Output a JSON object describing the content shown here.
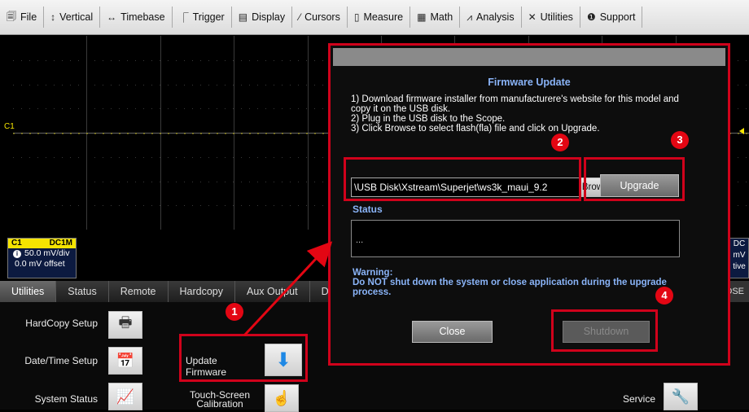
{
  "menu": [
    {
      "icon": "file-icon",
      "glyph": "🗐",
      "label": "File"
    },
    {
      "icon": "vertical-icon",
      "glyph": "↕",
      "label": "Vertical"
    },
    {
      "icon": "timebase-icon",
      "glyph": "↔",
      "label": "Timebase"
    },
    {
      "icon": "trigger-icon",
      "glyph": "⎾",
      "label": "Trigger"
    },
    {
      "icon": "display-icon",
      "glyph": "▤",
      "label": "Display"
    },
    {
      "icon": "cursors-icon",
      "glyph": "⁄",
      "label": "Cursors"
    },
    {
      "icon": "measure-icon",
      "glyph": "▯",
      "label": "Measure"
    },
    {
      "icon": "math-icon",
      "glyph": "▦",
      "label": "Math"
    },
    {
      "icon": "analysis-icon",
      "glyph": "⩘",
      "label": "Analysis"
    },
    {
      "icon": "utilities-icon",
      "glyph": "✕",
      "label": "Utilities"
    },
    {
      "icon": "support-icon",
      "glyph": "❶",
      "label": "Support"
    }
  ],
  "grid": {
    "channel_marker": "C1"
  },
  "channel": {
    "name": "C1",
    "coupling": "DC1M",
    "scale": "50.0 mV/div",
    "offset": "0.0 mV offset"
  },
  "channel_right": {
    "line1": "DC",
    "line2": "mV",
    "line3": "tive"
  },
  "tabs": [
    "Utilities",
    "Status",
    "Remote",
    "Hardcopy",
    "Aux Output",
    "D"
  ],
  "tab_close": "LOSE",
  "utilities": {
    "hardcopy_setup": "HardCopy Setup",
    "datetime_setup": "Date/Time Setup",
    "system_status": "System Status",
    "update_firmware": "Update Firmware",
    "touch_screen_line1": "Touch-Screen",
    "touch_screen_line2": "Calibration",
    "service": "Service"
  },
  "dialog": {
    "title": "Firmware Update",
    "step1": "1) Download firmware installer from manufacturere's website for this model and copy it on the USB disk.",
    "step2": "2) Plug in the USB disk to the Scope.",
    "step3": "3) Click Browse to select flash(fla) file and click on Upgrade.",
    "path": "\\USB Disk\\Xstream\\Superjet\\ws3k_maui_9.2",
    "browse": "Browse",
    "upgrade": "Upgrade",
    "status_label": "Status",
    "status_value": "...",
    "warning_label": "Warning:",
    "warning_text": "Do NOT shut down the system or close application during the upgrade process.",
    "close": "Close",
    "shutdown": "Shutdown"
  },
  "annotations": [
    "1",
    "2",
    "3",
    "4"
  ],
  "colors": {
    "highlight": "#d0021b",
    "badge": "#e30613",
    "trace": "#f5e400",
    "dialog_accent": "#8ab4f8"
  }
}
